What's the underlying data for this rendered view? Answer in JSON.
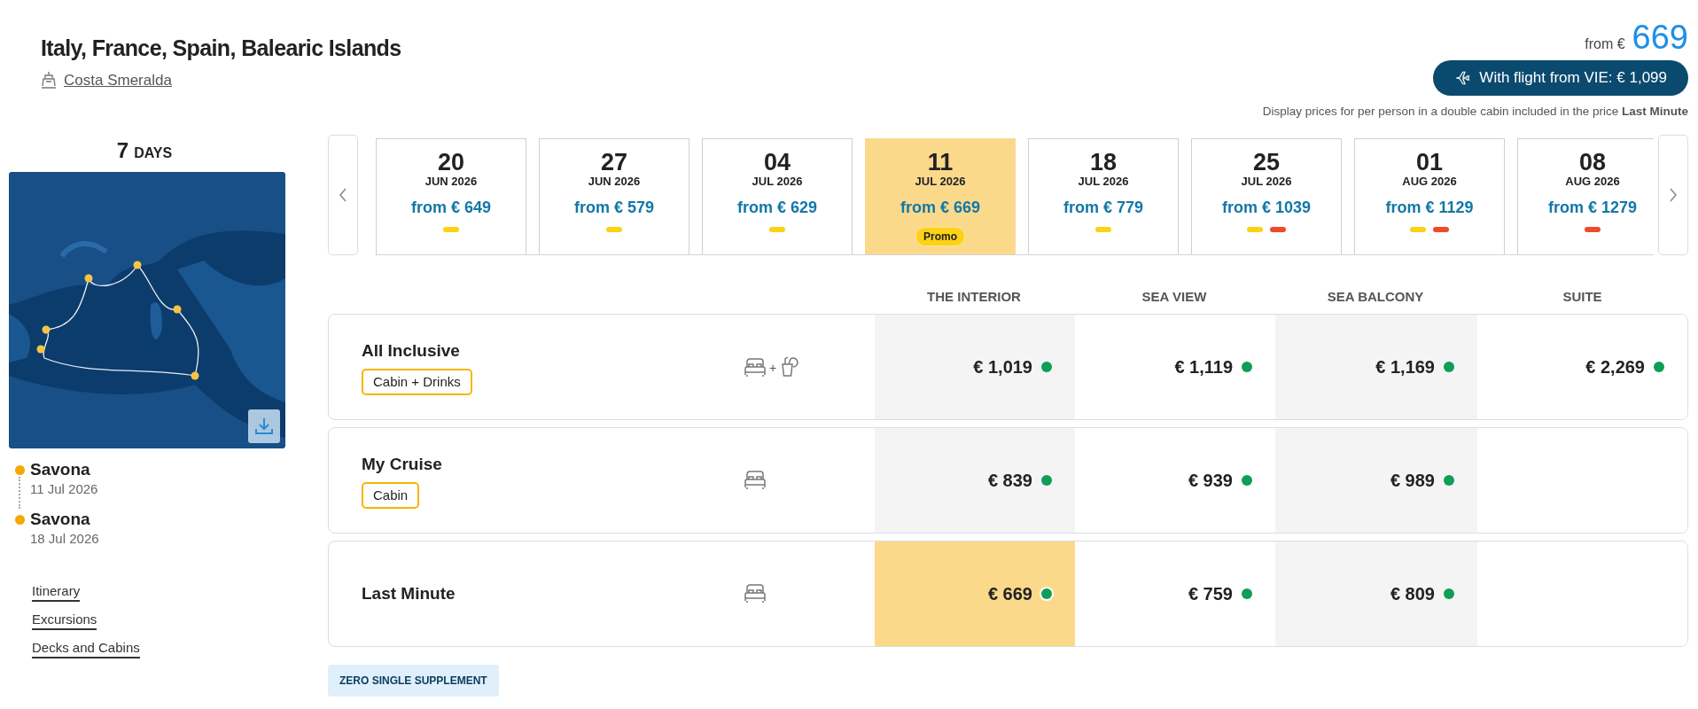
{
  "title": "Italy, France, Spain, Balearic Islands",
  "ship": "Costa Smeralda",
  "price": {
    "prefix": "from €",
    "amount": "669"
  },
  "flight_button": "With flight from VIE: € 1,099",
  "note": "Display prices for per person in a double cabin included in the price **Last Minute**",
  "duration": {
    "number": "7",
    "unit": "DAYS"
  },
  "map": {
    "kind": "picture"
  },
  "ports": [
    {
      "name": "Savona",
      "date": "11 Jul 2026"
    },
    {
      "name": "Savona",
      "date": "18 Jul 2026"
    }
  ],
  "links": [
    "Itinerary",
    "Excursions",
    "Decks and Cabins"
  ],
  "dates": [
    {
      "day": "20",
      "month": "JUN 2026",
      "price": "from € 649",
      "selected": false,
      "markers": [
        {
          "color": "#fcd116"
        }
      ]
    },
    {
      "day": "27",
      "month": "JUN 2026",
      "price": "from € 579",
      "selected": false,
      "markers": [
        {
          "color": "#fcd116"
        }
      ]
    },
    {
      "day": "04",
      "month": "JUL 2026",
      "price": "from € 629",
      "selected": false,
      "markers": [
        {
          "color": "#fcd116"
        }
      ]
    },
    {
      "day": "11",
      "month": "JUL 2026",
      "price": "from € 669",
      "selected": true,
      "badge": "Promo"
    },
    {
      "day": "18",
      "month": "JUL 2026",
      "price": "from € 779",
      "selected": false,
      "markers": [
        {
          "color": "#fcd116"
        }
      ]
    },
    {
      "day": "25",
      "month": "JUL 2026",
      "price": "from € 1039",
      "selected": false,
      "markers": [
        {
          "color": "#fcd116"
        },
        {
          "color": "#f04a2a"
        }
      ]
    },
    {
      "day": "01",
      "month": "AUG 2026",
      "price": "from € 1129",
      "selected": false,
      "markers": [
        {
          "color": "#fcd116"
        },
        {
          "color": "#f04a2a"
        }
      ]
    },
    {
      "day": "08",
      "month": "AUG 2026",
      "price": "from € 1279",
      "selected": false,
      "markers": [
        {
          "color": "#f04a2a"
        }
      ]
    }
  ],
  "columns": [
    "THE INTERIOR",
    "SEA VIEW",
    "SEA BALCONY",
    "SUITE"
  ],
  "rows": [
    {
      "name": "All Inclusive",
      "tag": "Cabin + Drinks",
      "amenities": [
        {
          "kind": "bed"
        },
        {
          "kind": "drinks"
        }
      ],
      "joiner": "+",
      "cells": [
        {
          "price": "€ 1,019",
          "selected": false
        },
        {
          "price": "€ 1,119",
          "selected": false
        },
        {
          "price": "€ 1,169",
          "selected": false
        },
        {
          "price": "€ 2,269",
          "selected": false
        }
      ]
    },
    {
      "name": "My Cruise",
      "tag": "Cabin",
      "amenities": [
        {
          "kind": "bed"
        }
      ],
      "cells": [
        {
          "price": "€ 839",
          "selected": false
        },
        {
          "price": "€ 939",
          "selected": false
        },
        {
          "price": "€ 989",
          "selected": false
        }
      ]
    },
    {
      "name": "Last Minute",
      "amenities": [
        {
          "kind": "bed"
        }
      ],
      "cells": [
        {
          "price": "€ 669",
          "selected": true
        },
        {
          "price": "€ 759",
          "selected": false
        },
        {
          "price": "€ 809",
          "selected": false
        }
      ]
    }
  ],
  "badge": "ZERO SINGLE SUPPLEMENT"
}
